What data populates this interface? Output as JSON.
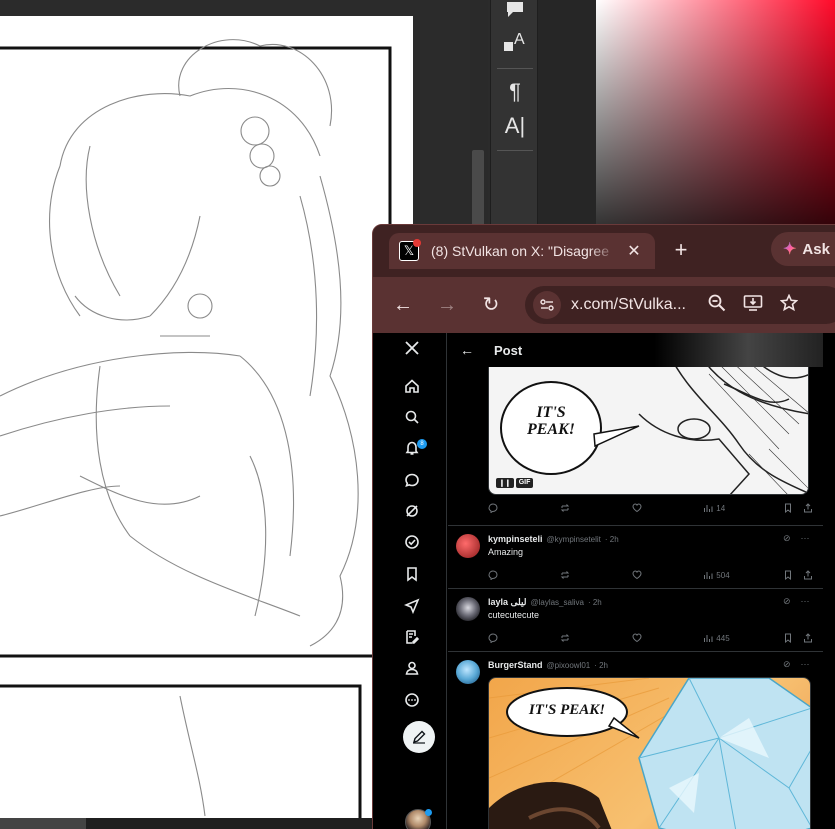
{
  "drawing_app": {
    "tools": {
      "comment_icon": "comment-icon",
      "shape_text_icon": "shape-text-icon",
      "paragraph_glyph": "¶",
      "text_tool_glyph": "A|"
    }
  },
  "browser": {
    "tab_title": "(8) StVulkan on X: \"Disagree",
    "tab_close": "✕",
    "new_tab": "+",
    "ask_label": "Ask",
    "url": "x.com/StVulka...",
    "nav": {
      "back": "←",
      "forward": "→",
      "reload": "↻"
    }
  },
  "x": {
    "header_title": "Post",
    "back_arrow": "←",
    "notification_count": "8",
    "nav_icons": [
      "x-logo-icon",
      "home-icon",
      "search-icon",
      "bell-icon",
      "messages-icon",
      "grok-icon",
      "verified-icon",
      "bookmark-icon",
      "rocket-icon",
      "edit-note-icon",
      "profile-icon",
      "more-icon"
    ],
    "media_top": {
      "speech": "IT'S PEAK!",
      "gif_badges": [
        "❙❙",
        "GIF"
      ],
      "views": "14"
    },
    "replies": [
      {
        "name": "kympinseteli",
        "handle": "@kympinsetelit",
        "time": "· 2h",
        "text": "Amazing",
        "views": "504",
        "avatar_color": "#c0392b"
      },
      {
        "name": "layla ليلى",
        "handle": "@laylas_saliva",
        "time": "· 2h",
        "text": "cutecutecute",
        "views": "445",
        "avatar_color": "#4a4a52"
      },
      {
        "name": "BurgerStand",
        "handle": "@pixoowl01",
        "time": "· 2h",
        "text": "",
        "views": "",
        "avatar_color": "#5aa9d6"
      }
    ],
    "media_bottom": {
      "speech": "IT'S PEAK!"
    },
    "colors": {
      "accent": "#1d9bf0",
      "text": "#e7e9ea",
      "muted": "#71767b",
      "border": "#2f3336"
    }
  }
}
